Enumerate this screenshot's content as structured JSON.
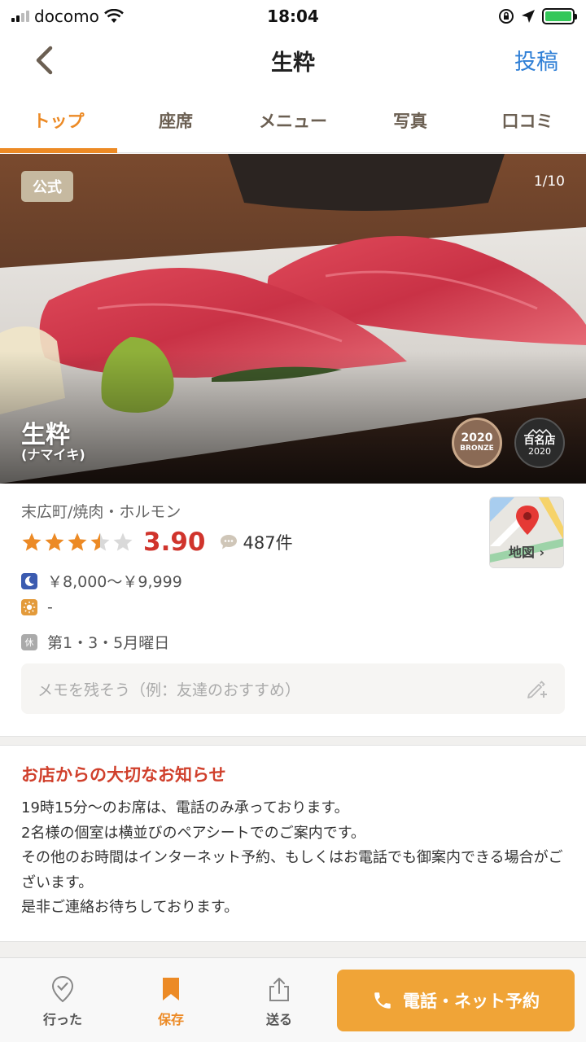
{
  "status_bar": {
    "carrier": "docomo",
    "time": "18:04"
  },
  "navbar": {
    "title": "生粋",
    "post_label": "投稿"
  },
  "tabs": [
    {
      "label": "トップ",
      "active": true
    },
    {
      "label": "座席"
    },
    {
      "label": "メニュー"
    },
    {
      "label": "写真"
    },
    {
      "label": "口コミ"
    }
  ],
  "hero": {
    "official_badge": "公式",
    "photo_counter": "1/10",
    "name": "生粋",
    "kana": "(ナマイキ)",
    "award_bronze_year": "2020",
    "award_bronze_label": "BRONZE",
    "award_hyaku_label": "百名店",
    "award_hyaku_year": "2020"
  },
  "info": {
    "category": "末広町/焼肉・ホルモン",
    "rating": "3.90",
    "review_count": "487件",
    "dinner_price": "￥8,000～￥9,999",
    "lunch_price": "-",
    "closed_label": "休",
    "closed_days": "第1・3・5月曜日",
    "map_label": "地図 ›",
    "memo_placeholder": "メモを残そう（例：友達のおすすめ）"
  },
  "notice": {
    "title": "お店からの大切なお知らせ",
    "lines": [
      "19時15分～のお席は、電話のみ承っております。",
      "2名様の個室は横並びのペアシートでのご案内です。",
      "その他のお時間はインターネット予約、もしくはお電話でも御案内できる場合がございます。",
      "是非ご連絡お待ちしております。"
    ]
  },
  "bottom_bar": {
    "went_label": "行った",
    "save_label": "保存",
    "share_label": "送る",
    "reserve_label": "電話・ネット予約"
  },
  "colors": {
    "accent": "#ec8a25",
    "rating": "#d0342c",
    "link": "#2f7fd6",
    "reserve_button": "#f0a437"
  }
}
